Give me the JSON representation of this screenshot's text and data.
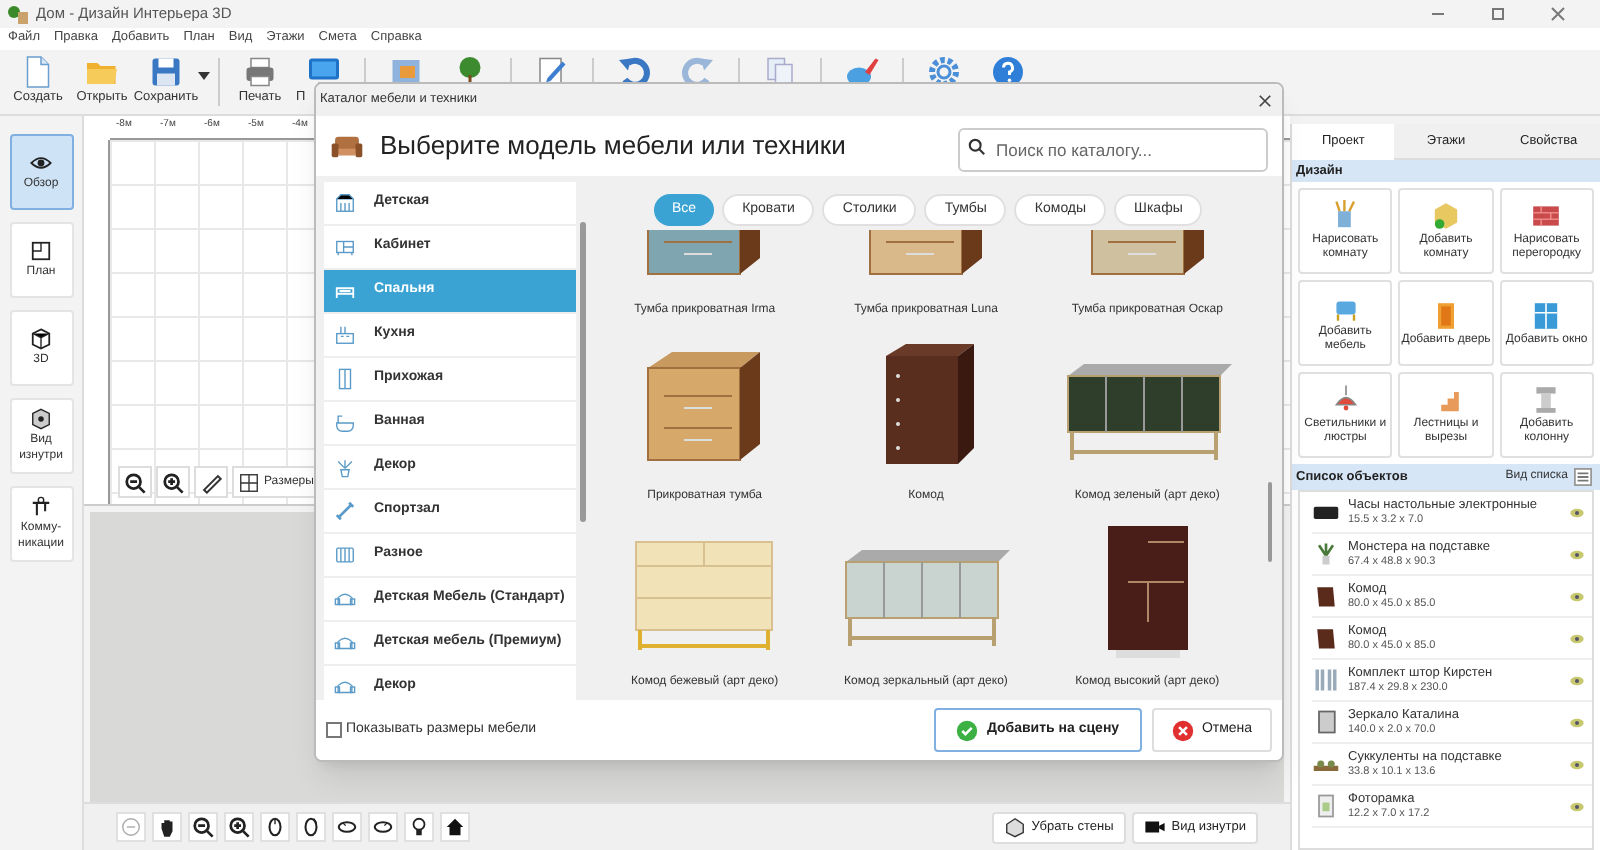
{
  "window": {
    "title": "Дом - Дизайн Интерьера 3D"
  },
  "menu": [
    "Файл",
    "Правка",
    "Добавить",
    "План",
    "Вид",
    "Этажи",
    "Смета",
    "Справка"
  ],
  "toolbar": [
    {
      "kind": "new",
      "label": "Создать"
    },
    {
      "kind": "open",
      "label": "Открыть"
    },
    {
      "kind": "save",
      "label": "Сохранить"
    },
    {
      "kind": "print",
      "label": "Печать"
    },
    {
      "kind": "monitor",
      "label": "П"
    },
    {
      "kind": "picture"
    },
    {
      "kind": "tree"
    },
    {
      "kind": "notepad"
    },
    {
      "kind": "undo"
    },
    {
      "kind": "redo"
    },
    {
      "kind": "copy"
    },
    {
      "kind": "paint"
    },
    {
      "kind": "settings"
    },
    {
      "kind": "help"
    }
  ],
  "view_modes": [
    {
      "kind": "eye",
      "label": "Обзор",
      "selected": true
    },
    {
      "kind": "plan",
      "label": "План",
      "selected": false
    },
    {
      "kind": "cube",
      "label": "3D",
      "selected": false
    },
    {
      "kind": "inside",
      "label": "Вид изнутри",
      "selected": false
    },
    {
      "kind": "pipes",
      "label": "Комму-никации",
      "selected": false
    }
  ],
  "plan": {
    "ruler_labels": [
      "-8м",
      "-7м",
      "-6м",
      "-5м",
      "-4м"
    ],
    "tools": [
      {
        "kind": "zoom_out"
      },
      {
        "kind": "zoom_in"
      },
      {
        "kind": "ruler"
      },
      {
        "kind": "dimensions",
        "label": "Размеры"
      }
    ]
  },
  "view3d": {
    "tools": [
      {
        "kind": "rotate360"
      },
      {
        "kind": "hand"
      },
      {
        "kind": "zoom_out"
      },
      {
        "kind": "zoom_in"
      },
      {
        "kind": "turn_left"
      },
      {
        "kind": "turn_right"
      },
      {
        "kind": "tilt_up"
      },
      {
        "kind": "tilt_down"
      },
      {
        "kind": "bulb"
      },
      {
        "kind": "home"
      }
    ],
    "buttons": [
      {
        "kind": "walls",
        "label": "Убрать стены"
      },
      {
        "kind": "camera",
        "label": "Вид изнутри"
      }
    ]
  },
  "right_panel": {
    "tabs": [
      {
        "label": "Проект",
        "selected": true
      },
      {
        "label": "Этажи",
        "selected": false
      },
      {
        "label": "Свойства",
        "selected": false
      }
    ],
    "design_title": "Дизайн",
    "design_tools": [
      {
        "kind": "draw_room",
        "label": "Нарисовать комнату"
      },
      {
        "kind": "add_room",
        "label": "Добавить комнату"
      },
      {
        "kind": "partition",
        "label": "Нарисовать перегородку"
      },
      {
        "kind": "furniture",
        "label": "Добавить мебель"
      },
      {
        "kind": "door",
        "label": "Добавить дверь"
      },
      {
        "kind": "window",
        "label": "Добавить окно"
      },
      {
        "kind": "lamp",
        "label": "Светильники и люстры"
      },
      {
        "kind": "stairs",
        "label": "Лестницы и вырезы"
      },
      {
        "kind": "column",
        "label": "Добавить колонну"
      }
    ],
    "objects_title": "Список объектов",
    "list_view": "Вид списка",
    "objects": [
      {
        "kind": "clock",
        "name": "Часы настольные электронные",
        "size": "15.5 x 3.2 x 7.0"
      },
      {
        "kind": "plant",
        "name": "Монстера на подставке",
        "size": "67.4 x 48.8 x 90.3"
      },
      {
        "kind": "dresser",
        "name": "Комод",
        "size": "80.0 x 45.0 x 85.0"
      },
      {
        "kind": "dresser",
        "name": "Комод",
        "size": "80.0 x 45.0 x 85.0"
      },
      {
        "kind": "curtains",
        "name": "Комплект штор Кирстен",
        "size": "187.4 x 29.8 x 230.0"
      },
      {
        "kind": "mirror",
        "name": "Зеркало Каталина",
        "size": "140.0 x 2.0 x 70.0"
      },
      {
        "kind": "succulents",
        "name": "Суккуленты на подставке",
        "size": "33.8 x 10.1 x 13.6"
      },
      {
        "kind": "frame",
        "name": "Фоторамка",
        "size": "12.2 x 7.0 x 17.2"
      }
    ]
  },
  "dialog": {
    "title": "Каталог мебели и техники",
    "heading": "Выберите модель мебели или техники",
    "search": {
      "placeholder": "Поиск по каталогу..."
    },
    "categories": [
      {
        "kind": "kids",
        "label": "Детская",
        "selected": false
      },
      {
        "kind": "office",
        "label": "Кабинет",
        "selected": false
      },
      {
        "kind": "bed",
        "label": "Спальня",
        "selected": true
      },
      {
        "kind": "kitchen",
        "label": "Кухня",
        "selected": false
      },
      {
        "kind": "hall",
        "label": "Прихожая",
        "selected": false
      },
      {
        "kind": "bath",
        "label": "Ванная",
        "selected": false
      },
      {
        "kind": "plant",
        "label": "Декор",
        "selected": false
      },
      {
        "kind": "gym",
        "label": "Спортзал",
        "selected": false
      },
      {
        "kind": "radiator",
        "label": "Разное",
        "selected": false
      },
      {
        "kind": "sofa",
        "label": "Детская Мебель (Стандарт)",
        "selected": false
      },
      {
        "kind": "sofa",
        "label": "Детская мебель (Премиум)",
        "selected": false
      },
      {
        "kind": "sofa",
        "label": "Декор",
        "selected": false
      }
    ],
    "filters": [
      {
        "label": "Все",
        "selected": true
      },
      {
        "label": "Кровати",
        "selected": false
      },
      {
        "label": "Столики",
        "selected": false
      },
      {
        "label": "Тумбы",
        "selected": false
      },
      {
        "label": "Комоды",
        "selected": false
      },
      {
        "label": "Шкафы",
        "selected": false
      }
    ],
    "products": [
      {
        "kind": "nightstand",
        "name": "Тумба прикроватная Irma"
      },
      {
        "kind": "open_nightstand",
        "name": "Тумба прикроватная Luna"
      },
      {
        "kind": "carved_nightstand",
        "name": "Тумба прикроватная Оскар"
      },
      {
        "kind": "nightstand",
        "name": "Прикроватная тумба"
      },
      {
        "kind": "dresser",
        "name": "Комод"
      },
      {
        "kind": "sideboard",
        "name": "Комод зеленый (арт деко)"
      },
      {
        "kind": "legged_dresser",
        "name": "Комод бежевый (арт деко)"
      },
      {
        "kind": "sideboard",
        "name": "Комод зеркальный (арт деко)"
      },
      {
        "kind": "tall_cabinet",
        "name": "Комод высокий (арт деко)"
      }
    ],
    "show_sizes": {
      "label": "Показывать размеры мебели",
      "checked": false
    },
    "buttons": [
      {
        "kind": "ok",
        "label": "Добавить на сцену"
      },
      {
        "kind": "cancel",
        "label": "Отмена"
      }
    ]
  }
}
